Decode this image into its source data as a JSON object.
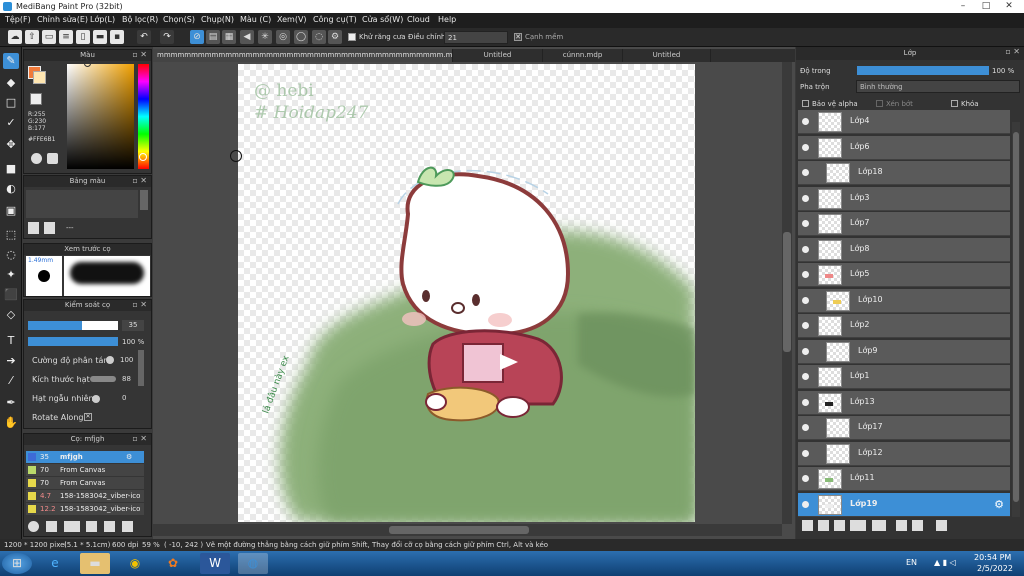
{
  "window": {
    "title": "MediBang Paint Pro (32bit)"
  },
  "menu": [
    "Tệp(F)",
    "Chỉnh sửa(E)",
    "Lớp(L)",
    "Bộ lọc(R)",
    "Chọn(S)",
    "Chụp(N)",
    "Màu (C)",
    "Xem(V)",
    "Công cụ(T)",
    "Cửa sổ(W)",
    "Cloud",
    "Help"
  ],
  "toolbar": {
    "antialias_label": "Khử răng cưa",
    "adjust_label": "Điều chỉnh",
    "adjust_value": "21",
    "soft_edge_label": "Cạnh mềm"
  },
  "tabs": [
    "mmmmmmmmmmmmmmmmmmmmmmmmmmmmmmmmmmmmmmmmmm.mdp",
    "Untitled",
    "cúnnn.mdp",
    "Untitled"
  ],
  "color_panel": {
    "title": "Màu",
    "r": "R:255",
    "g": "G:230",
    "b": "B:177",
    "hex": "#FFE6B1"
  },
  "palette_panel": {
    "title": "Bảng màu",
    "dash": "---"
  },
  "brush_preview": {
    "title": "Xem trước cọ",
    "size": "1.49mm"
  },
  "brush_control": {
    "title": "Kiểm soát cọ",
    "size_value": "35",
    "opacity_value": "100 %",
    "rows": [
      {
        "label": "Cường độ phân tán",
        "value": "100"
      },
      {
        "label": "Kích thước hạt",
        "value": "88"
      },
      {
        "label": "Hạt ngẫu nhiên",
        "value": "0"
      },
      {
        "label": "Rotate Along",
        "value": ""
      }
    ]
  },
  "brush_list": {
    "title": "Cọ: mfjgh",
    "items": [
      {
        "size": "35",
        "name": "mfjgh",
        "color": "#3d6bd6"
      },
      {
        "size": "70",
        "name": "From Canvas",
        "color": "#b9d86a"
      },
      {
        "size": "70",
        "name": "From Canvas",
        "color": "#e6d84a"
      },
      {
        "size": "4.7",
        "name": "158-1583042_viber-ico",
        "color": "#e6d84a"
      },
      {
        "size": "12.2",
        "name": "158-1583042_viber-ico",
        "color": "#e6d84a"
      }
    ]
  },
  "layer_panel": {
    "title": "Lớp",
    "opacity_label": "Độ trong",
    "opacity_value": "100 %",
    "opacity_fraction": 1.0,
    "blend_label": "Pha trộn",
    "blend_value": "Bình thường",
    "protect_alpha": "Bảo vệ alpha",
    "clipping": "Xén bớt",
    "lock": "Khóa"
  },
  "layers": [
    {
      "name": "Lớp4",
      "indent": false,
      "selected": false
    },
    {
      "name": "Lớp6",
      "indent": false,
      "selected": false
    },
    {
      "name": "Lớp18",
      "indent": true,
      "selected": false
    },
    {
      "name": "Lớp3",
      "indent": false,
      "selected": false
    },
    {
      "name": "Lớp7",
      "indent": false,
      "selected": false
    },
    {
      "name": "Lớp8",
      "indent": false,
      "selected": false
    },
    {
      "name": "Lớp5",
      "indent": false,
      "selected": false
    },
    {
      "name": "Lớp10",
      "indent": true,
      "selected": false
    },
    {
      "name": "Lớp2",
      "indent": false,
      "selected": false
    },
    {
      "name": "Lớp9",
      "indent": true,
      "selected": false
    },
    {
      "name": "Lớp1",
      "indent": false,
      "selected": false
    },
    {
      "name": "Lớp13",
      "indent": false,
      "selected": false
    },
    {
      "name": "Lớp17",
      "indent": true,
      "selected": false
    },
    {
      "name": "Lớp12",
      "indent": true,
      "selected": false
    },
    {
      "name": "Lớp11",
      "indent": false,
      "selected": false
    },
    {
      "name": "Lớp19",
      "indent": false,
      "selected": true
    }
  ],
  "canvas": {
    "watermark_line1": "@ hebi",
    "watermark_line2": "# Hoidap247",
    "side_text": "lá đâu này ex"
  },
  "status": {
    "size": "1200 * 1200 pixel",
    "dims": "(5.1 * 5.1cm)",
    "dpi": "600 dpi",
    "zoom": "59 %",
    "coords": "( -10, 242 )",
    "hint": "Vẽ một đường thẳng bằng cách giữ phím Shift, Thay đổi cỡ cọ bằng cách giữ phím Ctrl, Alt và kéo"
  },
  "taskbar": {
    "lang": "EN",
    "time": "20:54 PM",
    "date": "2/5/2022"
  }
}
